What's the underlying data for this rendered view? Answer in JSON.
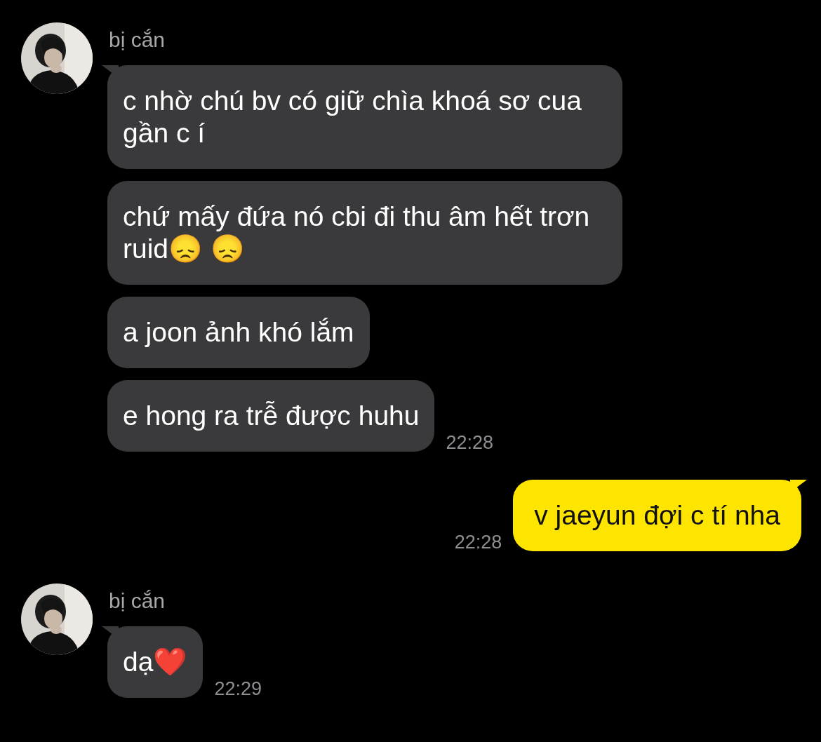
{
  "messages": [
    {
      "kind": "received",
      "sender": "bị cắn",
      "bubbles": [
        "c nhờ chú bv có giữ chìa khoá sơ cua gần c í",
        "chứ mấy đứa nó cbi đi thu âm hết trơn ruid😞 😞",
        "a joon ảnh khó lắm",
        "e hong ra trễ được huhu"
      ],
      "time": "22:28"
    },
    {
      "kind": "sent",
      "bubbles": [
        "v jaeyun đợi c tí nha"
      ],
      "time": "22:28"
    },
    {
      "kind": "received",
      "sender": "bị cắn",
      "bubbles": [
        "dạ❤️"
      ],
      "time": "22:29"
    }
  ]
}
